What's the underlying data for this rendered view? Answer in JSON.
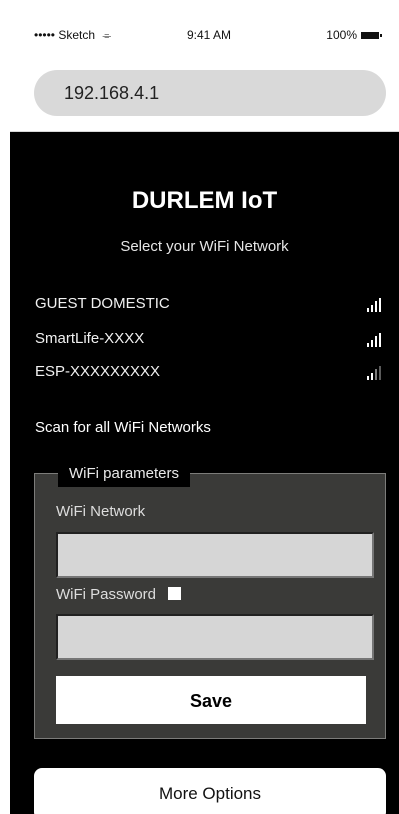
{
  "status_bar": {
    "carrier": "••••• Sketch",
    "time": "9:41 AM",
    "battery": "100%"
  },
  "browser": {
    "url": "192.168.4.1"
  },
  "page": {
    "title": "DURLEM IoT",
    "subtitle": "Select your WiFi Network",
    "networks": [
      {
        "name": "GUEST DOMESTIC",
        "signal": "full"
      },
      {
        "name": "SmartLife-XXXX",
        "signal": "full"
      },
      {
        "name": "ESP-XXXXXXXXX",
        "signal": "weak"
      }
    ],
    "scan_link": "Scan for all WiFi Networks",
    "wifi_params": {
      "legend": "WiFi parameters",
      "network_label": "WiFi Network",
      "network_value": "",
      "password_label": "WiFi Password",
      "password_value": "",
      "save_label": "Save"
    },
    "more_options_label": "More Options"
  },
  "colors": {
    "background": "#000000",
    "panel": "#3a3a38",
    "input": "#d6d6d6"
  },
  "icons": {
    "wifi": "wifi-icon",
    "battery": "battery-icon",
    "signal": "signal-strength-icon",
    "checkbox": "show-password-checkbox"
  }
}
